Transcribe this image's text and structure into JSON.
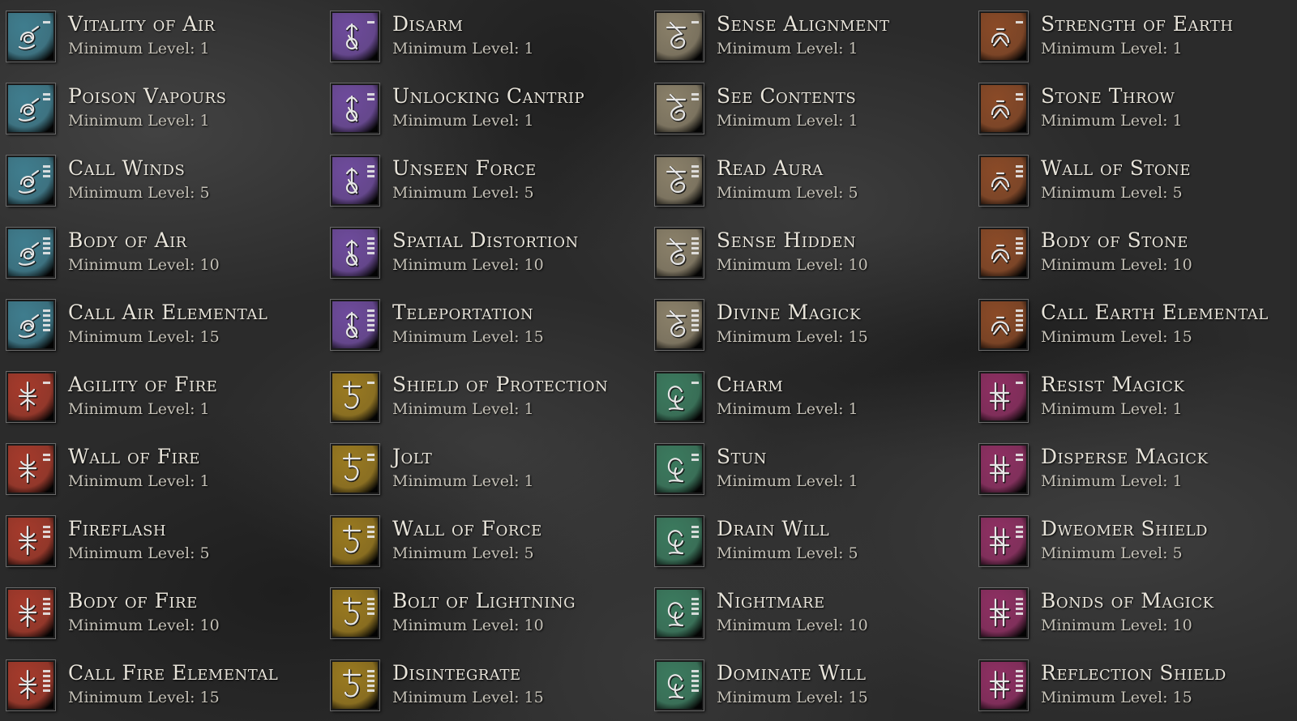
{
  "schools": [
    {
      "name": "air",
      "icon": "air-rune-icon",
      "color": "#3f7d8e",
      "spells": [
        {
          "name": "Vitality of Air",
          "level": "Minimum Level: 1",
          "rank": 1
        },
        {
          "name": "Poison Vapours",
          "level": "Minimum Level: 1",
          "rank": 2
        },
        {
          "name": "Call Winds",
          "level": "Minimum Level: 5",
          "rank": 3
        },
        {
          "name": "Body of Air",
          "level": "Minimum Level: 10",
          "rank": 4
        },
        {
          "name": "Call Air Elemental",
          "level": "Minimum Level: 15",
          "rank": 5
        }
      ]
    },
    {
      "name": "alteration",
      "icon": "alteration-rune-icon",
      "color": "#6e4b9c",
      "spells": [
        {
          "name": "Disarm",
          "level": "Minimum Level: 1",
          "rank": 1
        },
        {
          "name": "Unlocking Cantrip",
          "level": "Minimum Level: 1",
          "rank": 2
        },
        {
          "name": "Unseen Force",
          "level": "Minimum Level: 5",
          "rank": 3
        },
        {
          "name": "Spatial Distortion",
          "level": "Minimum Level: 10",
          "rank": 4
        },
        {
          "name": "Teleportation",
          "level": "Minimum Level: 15",
          "rank": 5
        }
      ]
    },
    {
      "name": "divination",
      "icon": "divination-rune-icon",
      "color": "#8a8069",
      "spells": [
        {
          "name": "Sense Alignment",
          "level": "Minimum Level: 1",
          "rank": 1
        },
        {
          "name": "See Contents",
          "level": "Minimum Level: 1",
          "rank": 2
        },
        {
          "name": "Read Aura",
          "level": "Minimum Level: 5",
          "rank": 3
        },
        {
          "name": "Sense Hidden",
          "level": "Minimum Level: 10",
          "rank": 4
        },
        {
          "name": "Divine Magick",
          "level": "Minimum Level: 15",
          "rank": 5
        }
      ]
    },
    {
      "name": "earth",
      "icon": "earth-rune-icon",
      "color": "#8a4a27",
      "spells": [
        {
          "name": "Strength of Earth",
          "level": "Minimum Level: 1",
          "rank": 1
        },
        {
          "name": "Stone Throw",
          "level": "Minimum Level: 1",
          "rank": 2
        },
        {
          "name": "Wall of Stone",
          "level": "Minimum Level: 5",
          "rank": 3
        },
        {
          "name": "Body of Stone",
          "level": "Minimum Level: 10",
          "rank": 4
        },
        {
          "name": "Call Earth Elemental",
          "level": "Minimum Level: 15",
          "rank": 5
        }
      ]
    },
    {
      "name": "fire",
      "icon": "fire-rune-icon",
      "color": "#a53a2b",
      "spells": [
        {
          "name": "Agility of Fire",
          "level": "Minimum Level: 1",
          "rank": 1
        },
        {
          "name": "Wall of Fire",
          "level": "Minimum Level: 1",
          "rank": 2
        },
        {
          "name": "Fireflash",
          "level": "Minimum Level: 5",
          "rank": 3
        },
        {
          "name": "Body of Fire",
          "level": "Minimum Level: 10",
          "rank": 4
        },
        {
          "name": "Call Fire Elemental",
          "level": "Minimum Level: 15",
          "rank": 5
        }
      ]
    },
    {
      "name": "protection",
      "icon": "protection-rune-icon",
      "color": "#9a7a20",
      "spells": [
        {
          "name": "Shield of Protection",
          "level": "Minimum Level: 1",
          "rank": 1
        },
        {
          "name": "Jolt",
          "level": "Minimum Level: 1",
          "rank": 2
        },
        {
          "name": "Wall of Force",
          "level": "Minimum Level: 5",
          "rank": 3
        },
        {
          "name": "Bolt of Lightning",
          "level": "Minimum Level: 10",
          "rank": 4
        },
        {
          "name": "Disintegrate",
          "level": "Minimum Level: 15",
          "rank": 5
        }
      ]
    },
    {
      "name": "enchantment",
      "icon": "enchantment-rune-icon",
      "color": "#3b7a5e",
      "spells": [
        {
          "name": "Charm",
          "level": "Minimum Level: 1",
          "rank": 1
        },
        {
          "name": "Stun",
          "level": "Minimum Level: 1",
          "rank": 2
        },
        {
          "name": "Drain Will",
          "level": "Minimum Level: 5",
          "rank": 3
        },
        {
          "name": "Nightmare",
          "level": "Minimum Level: 10",
          "rank": 4
        },
        {
          "name": "Dominate Will",
          "level": "Minimum Level: 15",
          "rank": 5
        }
      ]
    },
    {
      "name": "counter-magick",
      "icon": "counter-magick-rune-icon",
      "color": "#8e2f62",
      "spells": [
        {
          "name": "Resist Magick",
          "level": "Minimum Level: 1",
          "rank": 1
        },
        {
          "name": "Disperse Magick",
          "level": "Minimum Level: 1",
          "rank": 2
        },
        {
          "name": "Dweomer Shield",
          "level": "Minimum Level: 5",
          "rank": 3
        },
        {
          "name": "Bonds of Magick",
          "level": "Minimum Level: 10",
          "rank": 4
        },
        {
          "name": "Reflection Shield",
          "level": "Minimum Level: 15",
          "rank": 5
        }
      ]
    }
  ]
}
